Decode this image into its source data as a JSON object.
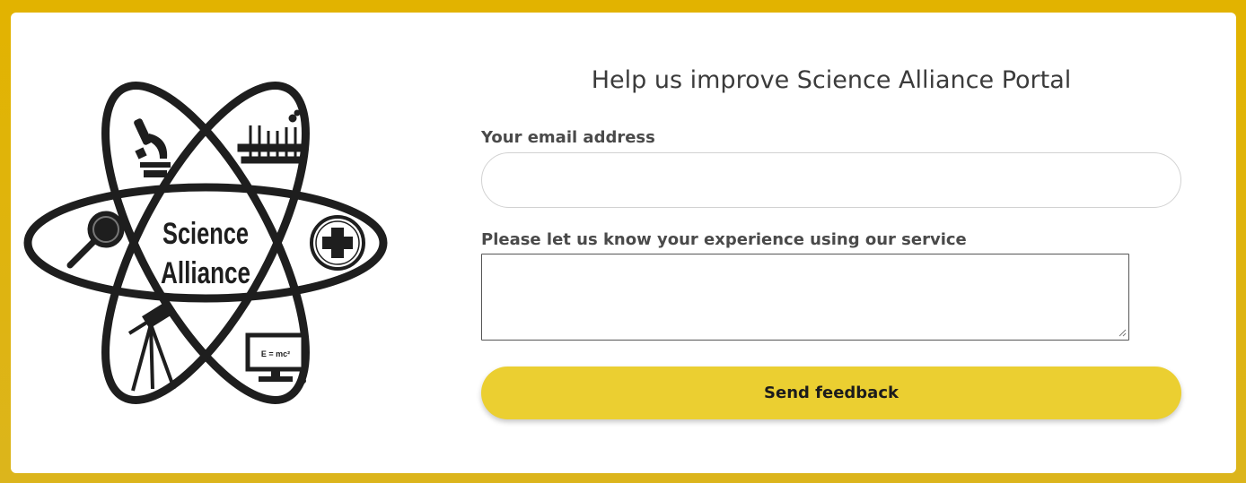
{
  "logo": {
    "line1": "Science",
    "line2": "Alliance",
    "formula": "E = mc²"
  },
  "form": {
    "title": "Help us improve Science Alliance Portal",
    "email_label": "Your email address",
    "email_value": "",
    "experience_label": "Please let us know your experience using our service",
    "experience_value": "",
    "submit_label": "Send feedback"
  },
  "colors": {
    "page_background": "#e2b300",
    "button": "#ebcf31",
    "card": "#ffffff"
  },
  "icons": [
    "microscope-icon",
    "test-tubes-icon",
    "magnifying-glass-icon",
    "medical-cross-icon",
    "telescope-icon",
    "computer-icon"
  ]
}
